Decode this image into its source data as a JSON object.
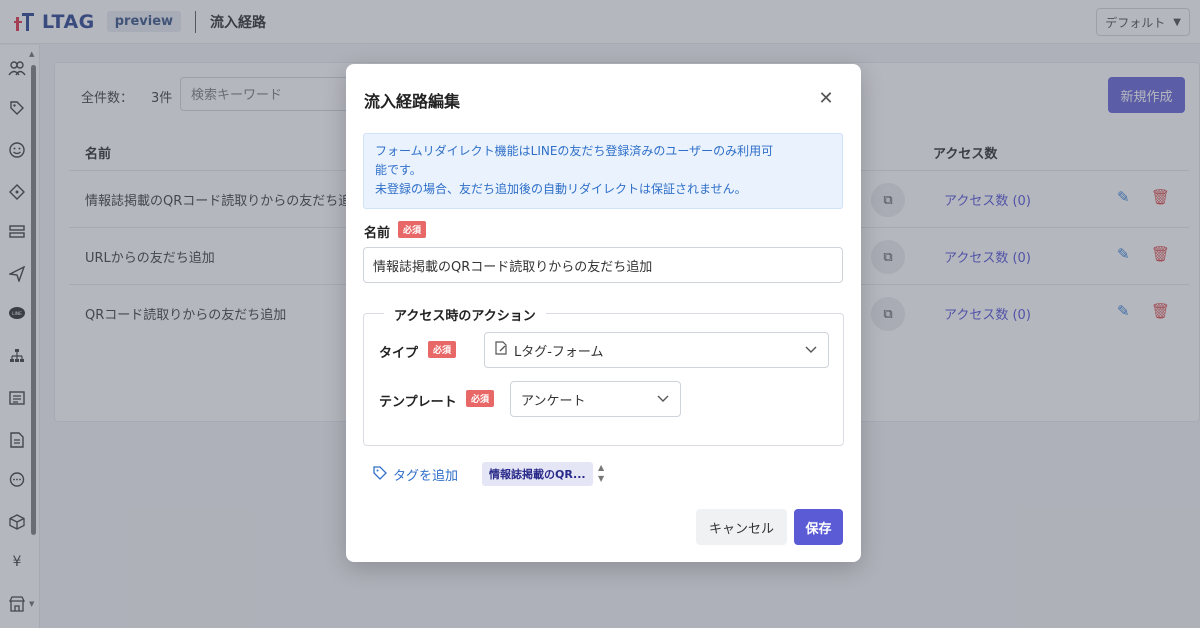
{
  "header": {
    "logo_text": "LTAG",
    "badge": "preview",
    "page_title": "流入経路",
    "profile_select": "デフォルト"
  },
  "sidebar": {
    "icons": [
      "users-icon",
      "tag-icon",
      "smile-icon",
      "ticket-icon",
      "list-icon",
      "send-icon",
      "line-icon",
      "sitemap-icon",
      "document-list-icon",
      "file-icon",
      "chat-icon",
      "box-icon",
      "yen-icon",
      "store-icon"
    ]
  },
  "list": {
    "count_label": "全件数：",
    "count_value": "3件",
    "search_placeholder": "検索キーワード",
    "new_button": "新規作成",
    "columns": {
      "name": "名前",
      "access": "アクセス数"
    },
    "rows": [
      {
        "name": "情報誌掲載のQRコード読取りからの友だち追加",
        "access": "アクセス数 (0)"
      },
      {
        "name": "URLからの友だち追加",
        "access": "アクセス数 (0)"
      },
      {
        "name": "QRコード読取りからの友だち追加",
        "access": "アクセス数 (0)"
      }
    ]
  },
  "modal": {
    "title": "流入経路編集",
    "info_lines": [
      "フォームリダイレクト機能はLINEの友だち登録済みのユーザーのみ利用可",
      "能です。",
      "未登録の場合、友だち追加後の自動リダイレクトは保証されません。"
    ],
    "name_label": "名前",
    "required_badge": "必須",
    "name_value": "情報誌掲載のQRコード読取りからの友だち追加",
    "action_legend": "アクセス時のアクション",
    "type_label": "タイプ",
    "type_value": "Lタグ-フォーム",
    "template_label": "テンプレート",
    "template_value": "アンケート",
    "add_tag": "タグを追加",
    "tag_chip": "情報誌掲載のQR...",
    "cancel": "キャンセル",
    "save": "保存"
  }
}
